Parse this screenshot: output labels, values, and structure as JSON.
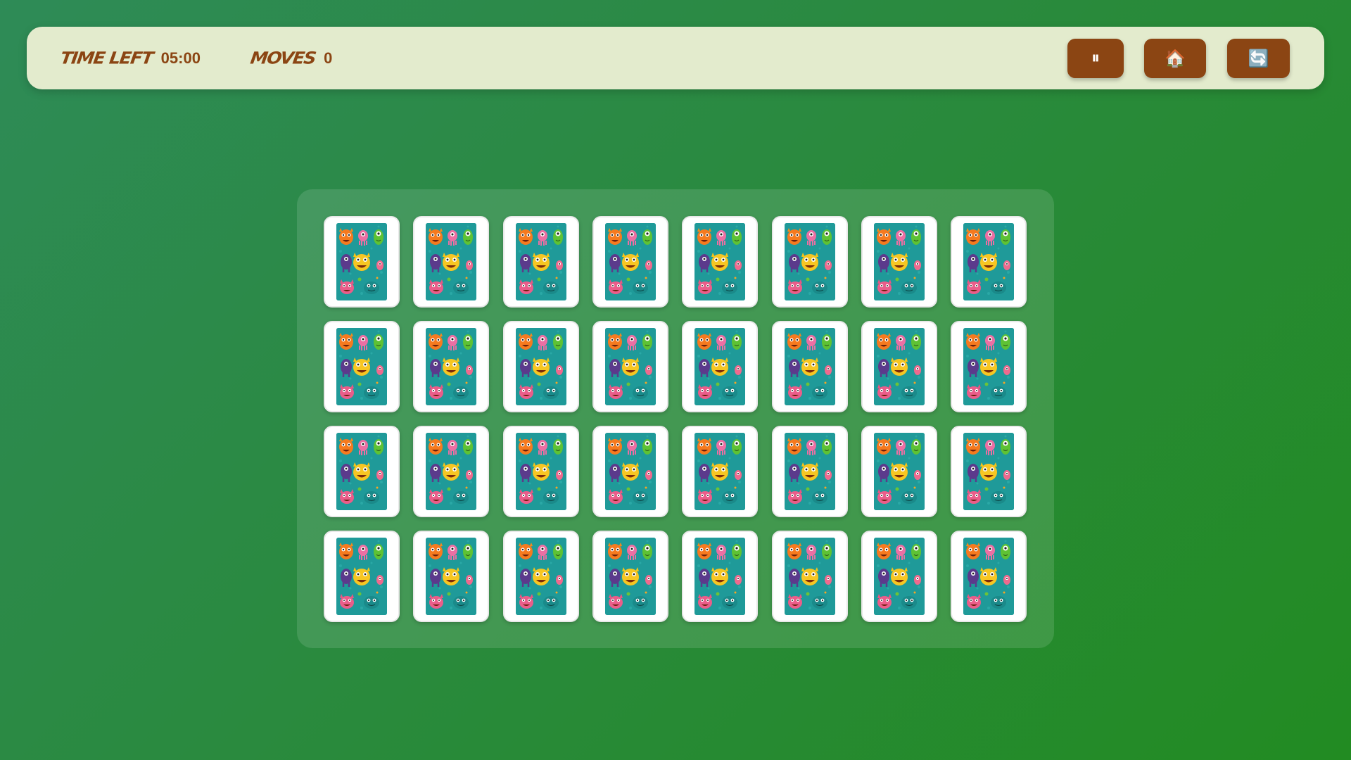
{
  "hud": {
    "time_label": "Time Left",
    "time_value": "05:00",
    "moves_label": "Moves",
    "moves_value": "0"
  },
  "controls": {
    "pause_glyph": "⏸",
    "home_glyph": "🏠",
    "restart_glyph": "🔄"
  },
  "board": {
    "rows": 4,
    "cols": 8,
    "card_state": "face-down",
    "card_back_design": "monster-pattern"
  },
  "colors": {
    "background": "#2e8b57",
    "hud_bg": "#e3ebcd",
    "accent_brown": "#8b4513",
    "card_back_teal": "#1f9a99"
  }
}
